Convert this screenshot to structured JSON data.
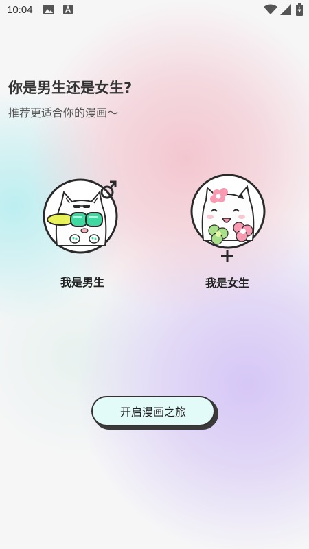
{
  "status_bar": {
    "time": "10:04",
    "icons": [
      "gallery-icon",
      "notification-a-icon",
      "wifi-icon",
      "signal-icon",
      "battery-charging-icon"
    ]
  },
  "prompt": {
    "title": "你是男生还是女生?",
    "subtitle": "推荐更适合你的漫画～"
  },
  "options": [
    {
      "id": "male",
      "label": "我是男生",
      "symbol_icon": "male-symbol-icon",
      "avatar_icon": "cool-cat-avatar-icon"
    },
    {
      "id": "female",
      "label": "我是女生",
      "symbol_icon": "female-symbol-icon",
      "avatar_icon": "flower-cat-avatar-icon"
    }
  ],
  "start_button": {
    "label": "开启漫画之旅"
  },
  "colors": {
    "button_fill": "#e2faf8",
    "sunglasses_green": "#3fd8a0",
    "cap_yellow": "#e8f05a",
    "flower_pink": "#f79ab2",
    "flower_green": "#a8e08a",
    "bg_pink": "#f3c4ce",
    "bg_cyan": "#baeef0",
    "bg_purple": "#d4c4f6"
  }
}
